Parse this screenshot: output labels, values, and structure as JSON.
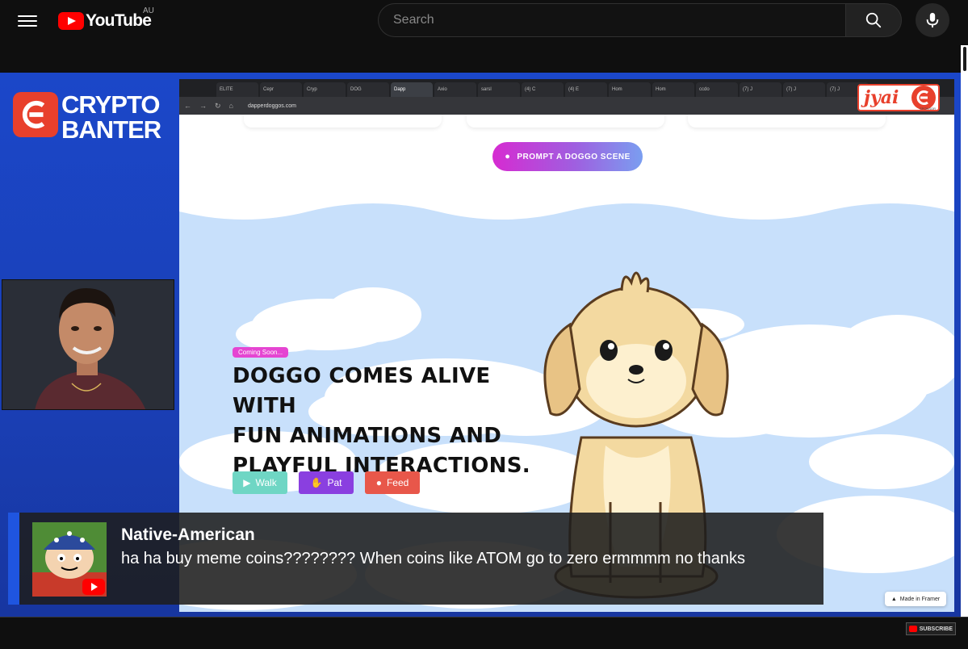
{
  "masthead": {
    "logo_text": "YouTube",
    "country": "AU",
    "search_placeholder": "Search"
  },
  "channel": {
    "brand_line1": "CRYPTO",
    "brand_line2": "BANTER"
  },
  "browser": {
    "tabs": [
      "ELITE",
      "Cepr",
      "Cryp",
      "DOG",
      "Dapp",
      "Axio",
      "sarsl",
      "(4) C",
      "(4) E",
      "Hom",
      "Hom",
      "ccdo",
      "(7) J",
      "(7) J",
      "(7) J"
    ],
    "active_tab_index": 4,
    "url": "dapperdoggos.com",
    "sponsor_word": "jyai",
    "sponsor_caption": "SPONSOR"
  },
  "page": {
    "prompt_button": "PROMPT A DOGGO SCENE",
    "coming_soon": "Coming Soon...",
    "headline_lines": [
      "DOGGO COMES ALIVE WITH",
      "FUN ANIMATIONS AND",
      "PLAYFUL INTERACTIONS."
    ],
    "actions": [
      {
        "label": "Walk",
        "color": "#6fd6c4"
      },
      {
        "label": "Pat",
        "color": "#8a3fe0"
      },
      {
        "label": "Feed",
        "color": "#e8574a"
      }
    ],
    "framer_badge": "Made in Framer"
  },
  "chat": {
    "author": "Native-American",
    "message": "ha ha buy meme coins???????? When coins like ATOM go to zero ermmmm no thanks"
  },
  "player": {
    "subscribe_label": "SUBSCRIBE"
  },
  "colors": {
    "youtube_red": "#ff0000",
    "channel_blue": "#1b47c9",
    "brand_orange": "#e8402c",
    "sky_blue": "#c8e0fb",
    "dog_fur": "#f3d9a0"
  }
}
